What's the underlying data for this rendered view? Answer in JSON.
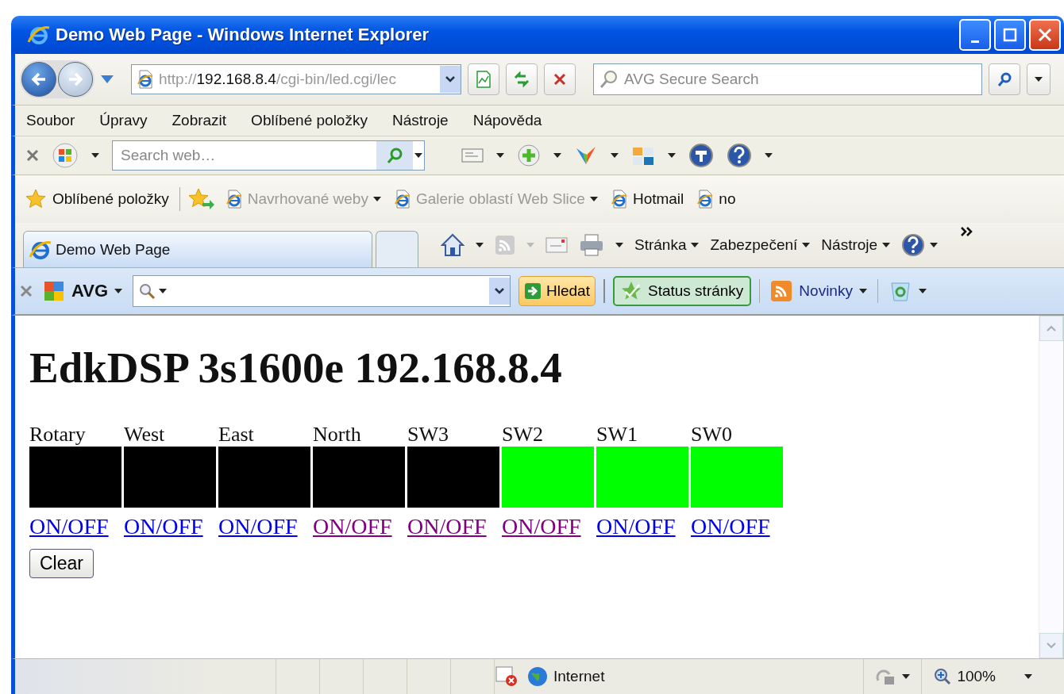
{
  "window": {
    "title": "Demo Web Page - Windows Internet Explorer"
  },
  "address_bar": {
    "prefix": "http://",
    "host": "192.168.8.4",
    "path": "/cgi-bin/led.cgi/lec"
  },
  "search_box": {
    "placeholder": "AVG Secure Search"
  },
  "menu": [
    "Soubor",
    "Úpravy",
    "Zobrazit",
    "Oblíbené položky",
    "Nástroje",
    "Nápověda"
  ],
  "web_search": {
    "placeholder": "Search web…"
  },
  "favorites_bar": {
    "label": "Oblíbené položky",
    "items": [
      {
        "label": "Navrhované weby",
        "disabled": true,
        "dropdown": true
      },
      {
        "label": "Galerie oblastí Web Slice",
        "disabled": true,
        "dropdown": true
      },
      {
        "label": "Hotmail",
        "disabled": false,
        "dropdown": false
      },
      {
        "label": "no",
        "disabled": false,
        "dropdown": false
      }
    ]
  },
  "tabs": [
    {
      "label": "Demo Web Page",
      "selected": true
    }
  ],
  "command_bar": [
    "Stránka",
    "Zabezpečení",
    "Nástroje"
  ],
  "avg_toolbar": {
    "logo": "AVG",
    "search_button": "Hledat",
    "status_button": "Status stránky",
    "news": "Novinky"
  },
  "page": {
    "heading": "EdkDSP 3s1600e 192.168.8.4",
    "leds": [
      {
        "label": "Rotary",
        "on": false,
        "link": "ON/OFF",
        "visited": false
      },
      {
        "label": "West",
        "on": false,
        "link": "ON/OFF",
        "visited": false
      },
      {
        "label": "East",
        "on": false,
        "link": "ON/OFF",
        "visited": false
      },
      {
        "label": "North",
        "on": false,
        "link": "ON/OFF",
        "visited": true
      },
      {
        "label": "SW3",
        "on": false,
        "link": "ON/OFF",
        "visited": true
      },
      {
        "label": "SW2",
        "on": true,
        "link": "ON/OFF",
        "visited": true
      },
      {
        "label": "SW1",
        "on": true,
        "link": "ON/OFF",
        "visited": false
      },
      {
        "label": "SW0",
        "on": true,
        "link": "ON/OFF",
        "visited": false
      }
    ],
    "button": "Clear"
  },
  "status_bar": {
    "zone": "Internet",
    "zoom": "100%"
  }
}
